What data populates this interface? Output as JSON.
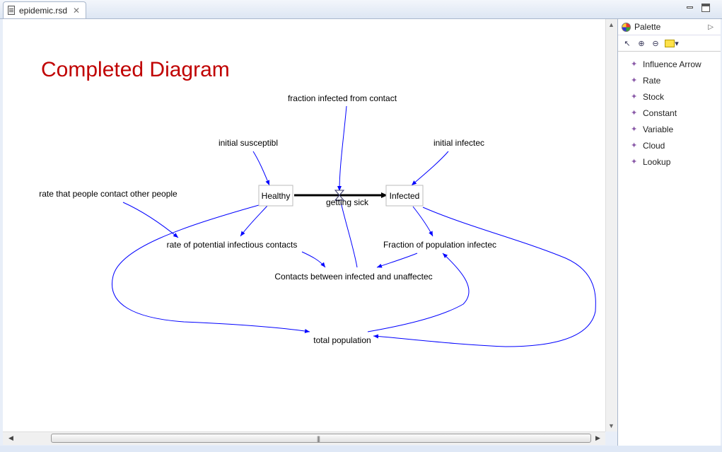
{
  "editor": {
    "tab_title": "epidemic.rsd",
    "close_glyph": "✕"
  },
  "diagram": {
    "title": "Completed Diagram",
    "title_color": "#c00000",
    "link_color": "#0000ff",
    "stocks": {
      "healthy": "Healthy",
      "infected": "Infected"
    },
    "flows": {
      "getting_sick": "getting sick"
    },
    "variables": {
      "fraction_infected": "fraction infected from contact",
      "initial_susceptible": "initial susceptibl",
      "initial_infected": "initial infectec",
      "contact_rate": "rate that people contact other people",
      "potential_contacts": "rate of potential infectious contacts",
      "fraction_population": "Fraction of population infectec",
      "contacts_between": "Contacts between infected and unaffectec",
      "total_population": "total population"
    }
  },
  "palette": {
    "title": "Palette",
    "tools": [
      "select-arrow-icon",
      "zoom-in-icon",
      "zoom-out-icon",
      "note-icon"
    ],
    "items": [
      "Influence Arrow",
      "Rate",
      "Stock",
      "Constant",
      "Variable",
      "Cloud",
      "Lookup"
    ]
  }
}
